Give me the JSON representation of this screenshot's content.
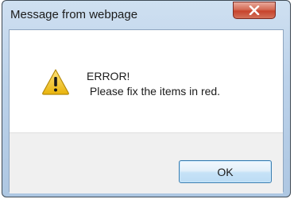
{
  "dialog": {
    "title": "Message from webpage",
    "message_line1": "ERROR!",
    "message_line2": " Please fix the items in red.",
    "icon": "warning-icon",
    "ok_label": "OK",
    "close_icon": "close-icon"
  },
  "colors": {
    "close_button": "#c7432c",
    "warning_yellow": "#f3c81c",
    "ok_button_border": "#3c7fb1"
  }
}
